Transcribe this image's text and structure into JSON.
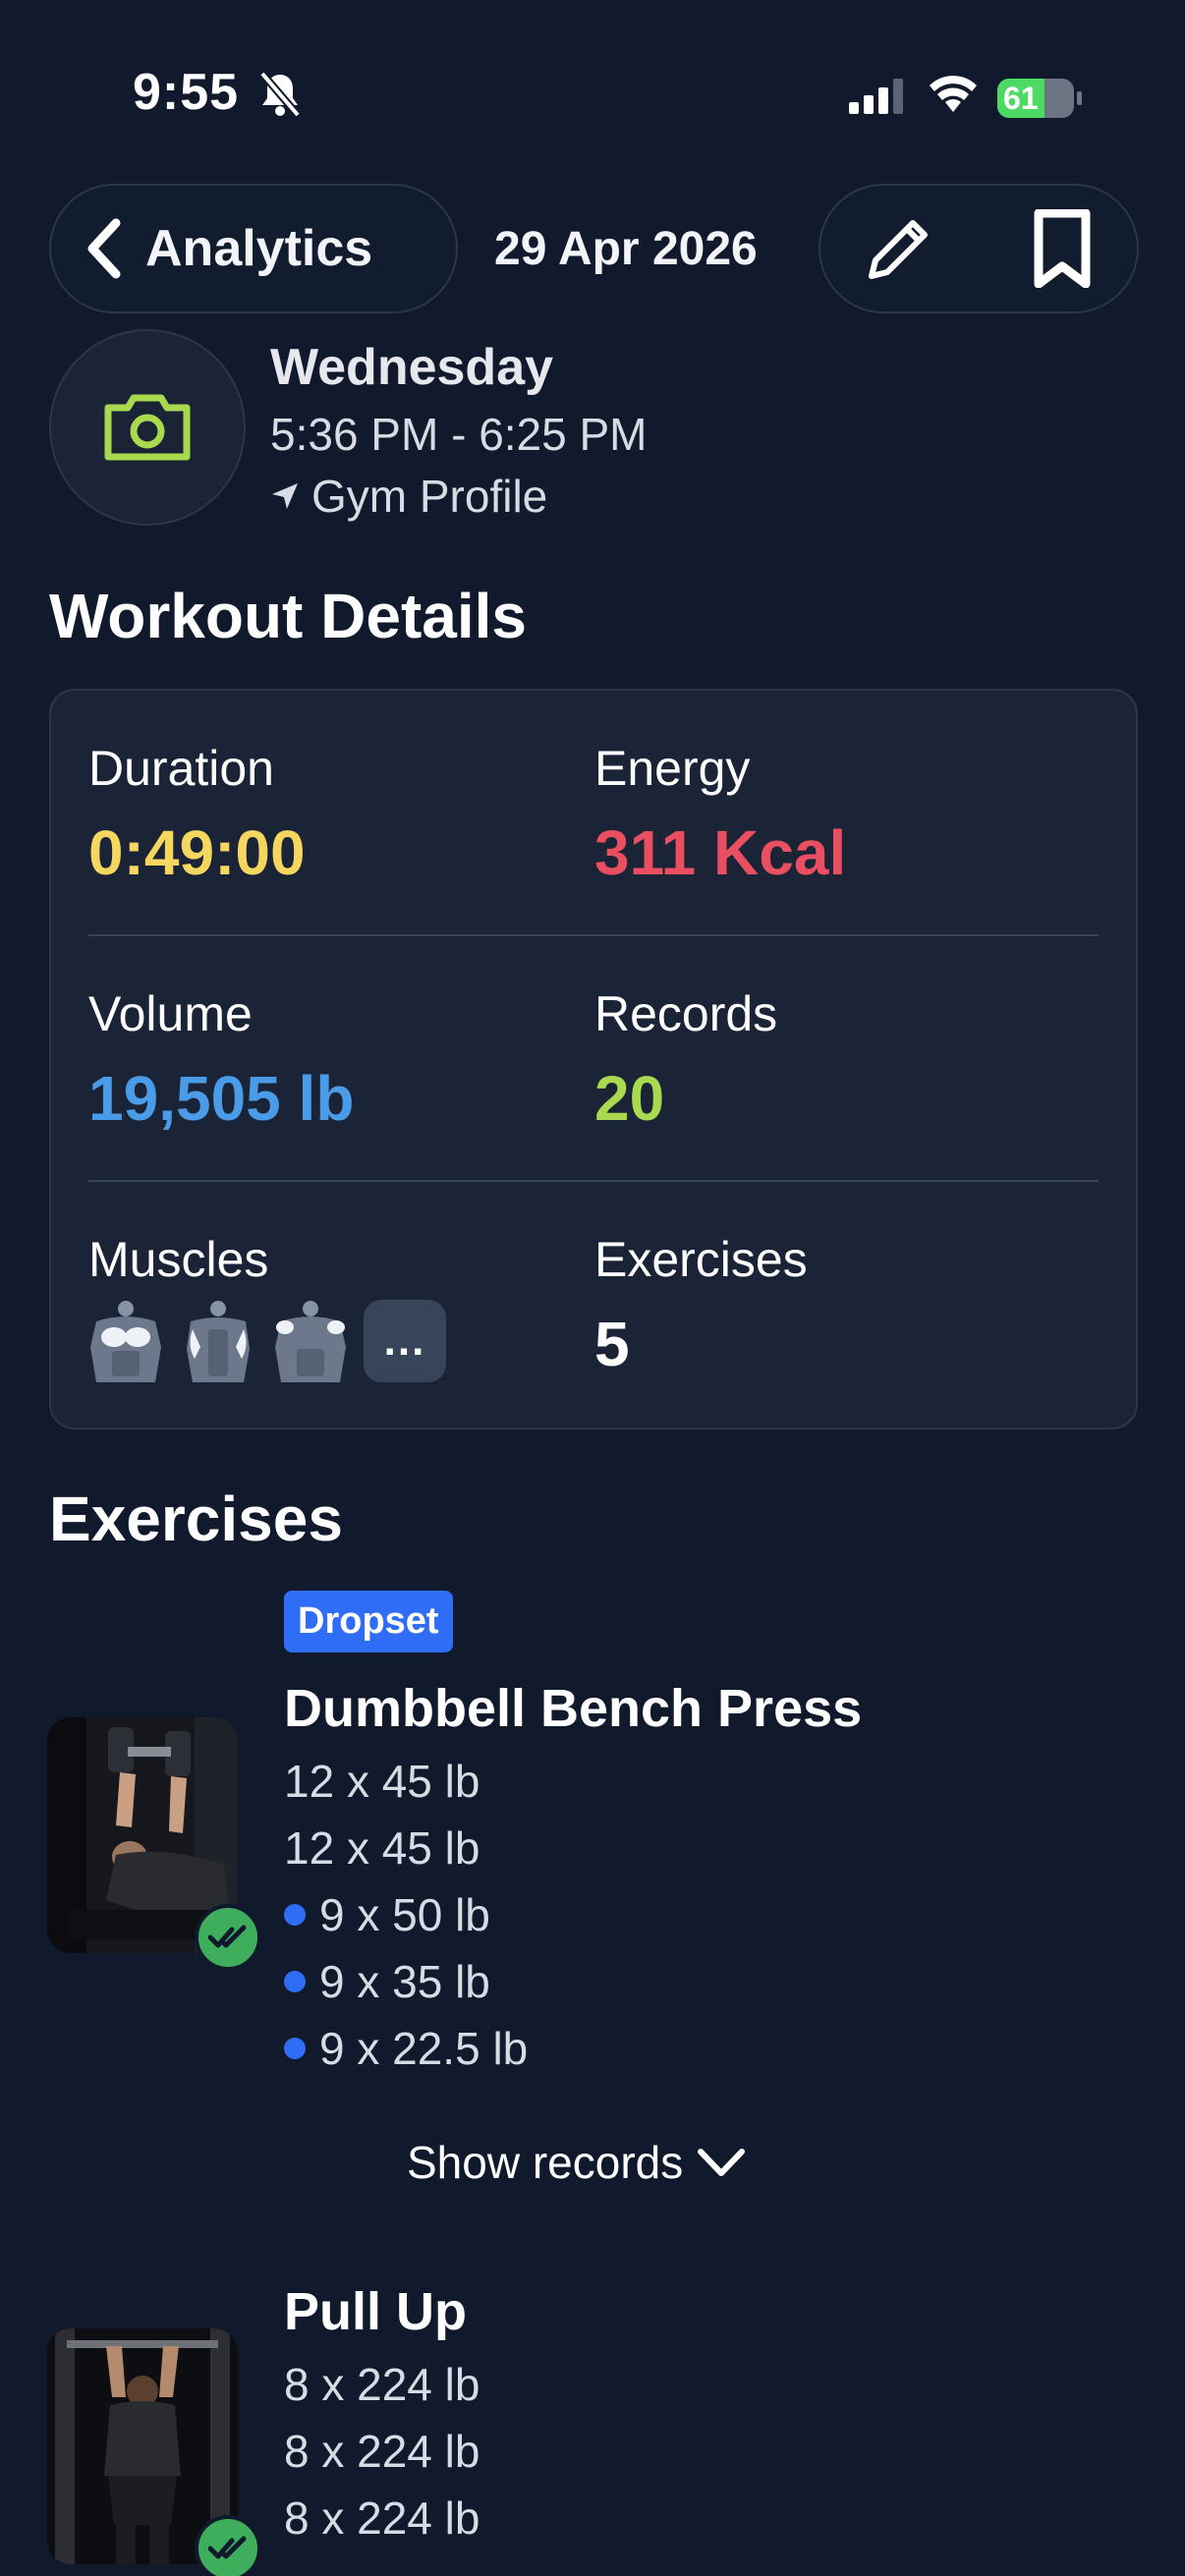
{
  "status_bar": {
    "time": "9:55",
    "battery": "61",
    "battery_level": 0.61
  },
  "header": {
    "back_label": "Analytics",
    "date": "29 Apr 2026"
  },
  "workout": {
    "day": "Wednesday",
    "time_range": "5:36 PM - 6:25 PM",
    "location": "Gym Profile"
  },
  "details": {
    "title": "Workout Details",
    "duration": {
      "label": "Duration",
      "value": "0:49:00",
      "color": "#f5d760"
    },
    "energy": {
      "label": "Energy",
      "value": "311 Kcal",
      "color": "#ea4e61"
    },
    "volume": {
      "label": "Volume",
      "value": "19,505 lb",
      "color": "#4a9ce8"
    },
    "records": {
      "label": "Records",
      "value": "20",
      "color": "#a8d94e"
    },
    "muscles": {
      "label": "Muscles",
      "more": "..."
    },
    "exercises": {
      "label": "Exercises",
      "value": "5",
      "color": "#ffffff"
    }
  },
  "exercises_title": "Exercises",
  "exercise_list": [
    {
      "badge": "Dropset",
      "name": "Dumbbell Bench Press",
      "sets": [
        "12 x 45 lb",
        "12 x 45 lb",
        "9 x 50 lb",
        "9 x 35 lb",
        "9 x 22.5 lb"
      ],
      "show_records": "Show records"
    },
    {
      "name": "Pull Up",
      "sets": [
        "8 x 224 lb",
        "8 x 224 lb",
        "8 x 224 lb"
      ]
    }
  ],
  "colors": {
    "background": "#101a2c",
    "card": "#1b2436",
    "accent_blue": "#2f6df6",
    "check_green": "#3fae5c",
    "camera_green": "#a8d94e"
  }
}
